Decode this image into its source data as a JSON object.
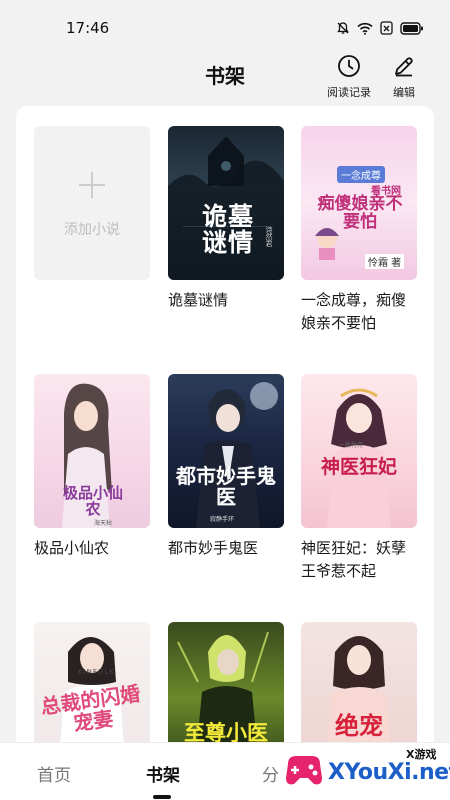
{
  "status_bar": {
    "time": "17:46",
    "icons": [
      "bell-off-icon",
      "wifi-icon",
      "sim-x-icon",
      "battery-icon"
    ]
  },
  "header": {
    "title": "书架",
    "history_label": "阅读记录",
    "history_icon": "clock-icon",
    "edit_label": "编辑",
    "edit_icon": "pencil-icon"
  },
  "shelf": {
    "add_card": {
      "label": "添加小说",
      "icon": "plus-icon"
    },
    "books": [
      {
        "title": "诡墓谜情",
        "cover_text": "诡墓谜情",
        "cover_author": "诗然君"
      },
      {
        "title": "一念成尊，痴傻娘亲不要怕",
        "cover_text": "痴傻娘亲不要怕",
        "cover_author": "怜霜 著",
        "cover_tag": "一念成尊",
        "cover_badge": "看书网"
      },
      {
        "title": "极品小仙农",
        "cover_text": "极品小仙农",
        "cover_author": "海天秋"
      },
      {
        "title": "都市妙手鬼医",
        "cover_text": "都市妙手鬼医",
        "cover_author": "寂静手环"
      },
      {
        "title": "神医狂妃：妖孽王爷惹不起",
        "cover_text": "神医狂妃",
        "cover_author": "一枚竹月"
      },
      {
        "title": "",
        "cover_text": "总裁的闪婚宠妻",
        "cover_tag": "KINFOLK"
      },
      {
        "title": "",
        "cover_text": "至尊小医仙"
      },
      {
        "title": "",
        "cover_text": "绝宠"
      }
    ]
  },
  "bottom_nav": {
    "tabs": [
      {
        "label": "首页",
        "active": false
      },
      {
        "label": "书架",
        "active": true
      },
      {
        "label": "分",
        "active": false
      }
    ]
  },
  "watermark": {
    "text": "XYouXi.net",
    "small": "X游戏"
  },
  "colors": {
    "accent": "#111111",
    "background": "#f2f2f2",
    "card": "#ffffff",
    "watermark_blue": "#1d5fc8"
  }
}
